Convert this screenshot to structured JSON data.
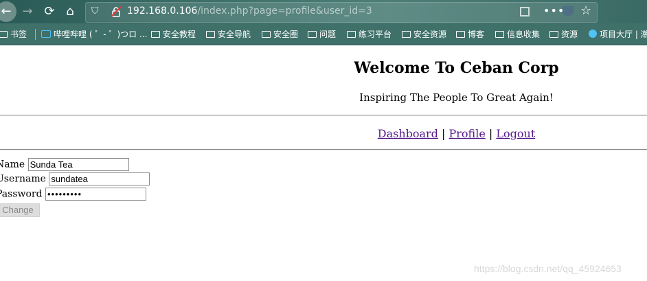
{
  "browser": {
    "url_host": "192.168.0.106",
    "url_path": "/index.php?page=profile&user_id=3"
  },
  "bookmarks": [
    {
      "label": "书签",
      "icon": "folder-icon"
    },
    {
      "label": "哔哩哔哩 ( ゜- ゜)つロ ...",
      "icon": "bilibili-icon"
    },
    {
      "label": "安全教程",
      "icon": "folder-icon"
    },
    {
      "label": "安全导航",
      "icon": "folder-icon"
    },
    {
      "label": "安全圈",
      "icon": "folder-icon"
    },
    {
      "label": "问题",
      "icon": "folder-icon"
    },
    {
      "label": "练习平台",
      "icon": "folder-icon"
    },
    {
      "label": "安全资源",
      "icon": "folder-icon"
    },
    {
      "label": "博客",
      "icon": "folder-icon"
    },
    {
      "label": "信息收集",
      "icon": "folder-icon"
    },
    {
      "label": "资源",
      "icon": "folder-icon"
    },
    {
      "label": "项目大厅 | 潮",
      "icon": "site-icon"
    }
  ],
  "page": {
    "title": "Welcome To Ceban Corp",
    "subtitle": "Inspiring The People To Great Again!",
    "nav": {
      "dashboard": "Dashboard",
      "separator": "|",
      "profile": "Profile",
      "logout": "Logout"
    },
    "form": {
      "name_label": "Name",
      "name_value": "Sunda Tea",
      "username_label": "Username",
      "username_value": "sundatea",
      "password_label": "Password",
      "password_value": "123456789",
      "change_label": "Change"
    }
  },
  "watermark": "https://blog.csdn.net/qq_45924653"
}
